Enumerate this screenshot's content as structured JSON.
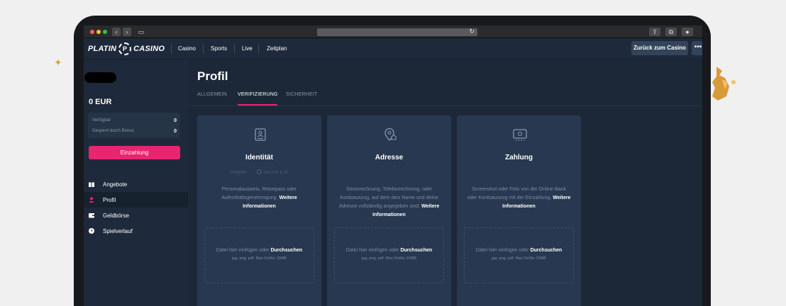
{
  "browser": {
    "back_icon": "chevron-left-icon",
    "forward_icon": "chevron-right-icon",
    "reload_icon": "reload-icon"
  },
  "nav": {
    "logo_left": "PLATIN",
    "logo_right": "CASINO",
    "links": [
      "Casino",
      "Sports",
      "Live",
      "Zeitplan"
    ],
    "back_button": "Zurück zum Casino",
    "more_button": "•••"
  },
  "sidebar": {
    "balance": "0 EUR",
    "available_label": "Verfügbar",
    "available_value": "0",
    "locked_label": "Gesperrt durch Bonus",
    "locked_value": "0",
    "deposit_button": "Einzahlung",
    "menu": [
      {
        "label": "Angebote",
        "icon": "gift-icon"
      },
      {
        "label": "Profil",
        "icon": "user-icon"
      },
      {
        "label": "Geldbörse",
        "icon": "wallet-icon"
      },
      {
        "label": "Spielverlauf",
        "icon": "clock-icon"
      }
    ]
  },
  "page": {
    "title": "Profil",
    "tabs": [
      "ALLGEMEIN",
      "VERIFIZIERUNG",
      "SICHERHEIT"
    ],
    "active_tab": "VERIFIZIERUNG"
  },
  "cards": [
    {
      "title": "Identität",
      "icon": "id-document-icon",
      "badge_primary": "PRIMÄR",
      "badge_secondary": "SELFIE & ID",
      "desc": "Personalausweis, Reisepass oder Aufenthaltsgenehmigung.",
      "more": "Weitere Informationen"
    },
    {
      "title": "Adresse",
      "icon": "location-icon",
      "desc": "Stromrechnung, Telefonrechnung, oder Kontoauszug, auf dem dein Name und deine Adresse vollständig angegeben sind.",
      "more": "Weitere Informationen"
    },
    {
      "title": "Zahlung",
      "icon": "payment-icon",
      "desc": "Screenshot oder Foto von der Online-Bank oder Kontoauszug mit der Einzahlung.",
      "more": "Weitere Informationen"
    }
  ],
  "dropzone": {
    "text": "Datei hier einfügen oder",
    "link": "Durchsuchen",
    "hint": "jpg, png, pdf. Max Größe 10MB"
  },
  "colors": {
    "accent": "#e8266f",
    "background": "#1c2838",
    "card": "#273850"
  }
}
